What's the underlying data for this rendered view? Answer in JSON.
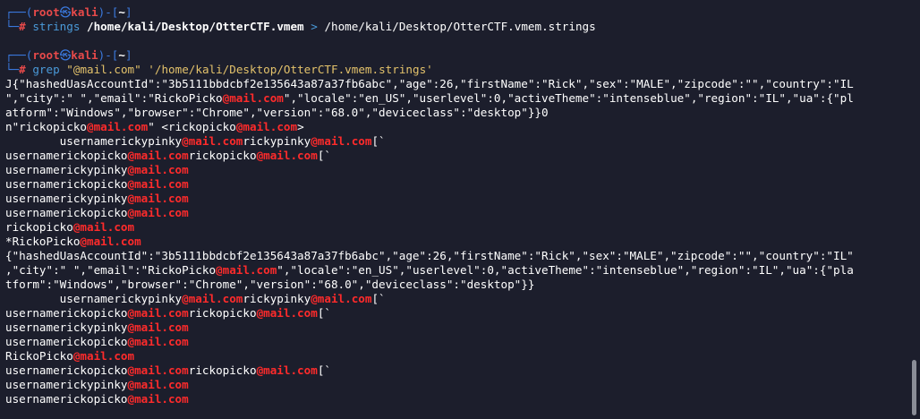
{
  "prompt": {
    "user": "root",
    "skull_icon": "skull-icon",
    "host": "kali",
    "cwd": "~"
  },
  "commands": [
    {
      "program": "strings",
      "arg1": "/home/kali/Desktop/OtterCTF.vmem",
      "operator": ">",
      "arg2": "/home/kali/Desktop/OtterCTF.vmem.strings"
    },
    {
      "program": "grep",
      "arg1": "\"@mail.com\"",
      "arg2": "'/home/kali/Desktop/OtterCTF.vmem.strings'"
    }
  ],
  "output_lines": [
    [
      "J{\"hashedUasAccountId\":\"3b5111bbdcbf2e135643a87a37fb6abc\",\"age\":26,\"firstName\":\"Rick\",\"sex\":\"MALE\",\"zipcode\":\"\",\"country\":\"IL"
    ],
    [
      "\",\"city\":\" \",\"email\":\"RickoPicko",
      "@mail.com",
      "\",\"locale\":\"en_US\",\"userlevel\":0,\"activeTheme\":\"intenseblue\",\"region\":\"IL\",\"ua\":{\"pl"
    ],
    [
      "atform\":\"Windows\",\"browser\":\"Chrome\",\"version\":\"68.0\",\"deviceclass\":\"desktop\"}}0"
    ],
    [
      "n\"rickopicko",
      "@mail.com",
      "\" <rickopicko",
      "@mail.com",
      ">"
    ],
    [
      "        usernamerickypinky",
      "@mail.com",
      "rickypinky",
      "@mail.com",
      "[`"
    ],
    [
      "usernamerickopicko",
      "@mail.com",
      "rickopicko",
      "@mail.com",
      "[`"
    ],
    [
      "usernamerickypinky",
      "@mail.com"
    ],
    [
      "usernamerickopicko",
      "@mail.com"
    ],
    [
      "usernamerickypinky",
      "@mail.com"
    ],
    [
      "usernamerickopicko",
      "@mail.com"
    ],
    [
      "rickopicko",
      "@mail.com"
    ],
    [
      "*RickoPicko",
      "@mail.com"
    ],
    [
      "{\"hashedUasAccountId\":\"3b5111bbdcbf2e135643a87a37fb6abc\",\"age\":26,\"firstName\":\"Rick\",\"sex\":\"MALE\",\"zipcode\":\"\",\"country\":\"IL\""
    ],
    [
      ",\"city\":\" \",\"email\":\"RickoPicko",
      "@mail.com",
      "\",\"locale\":\"en_US\",\"userlevel\":0,\"activeTheme\":\"intenseblue\",\"region\":\"IL\",\"ua\":{\"pla"
    ],
    [
      "tform\":\"Windows\",\"browser\":\"Chrome\",\"version\":\"68.0\",\"deviceclass\":\"desktop\"}}"
    ],
    [
      "        usernamerickypinky",
      "@mail.com",
      "rickypinky",
      "@mail.com",
      "[`"
    ],
    [
      "usernamerickopicko",
      "@mail.com",
      "rickopicko",
      "@mail.com",
      "[`"
    ],
    [
      "usernamerickypinky",
      "@mail.com"
    ],
    [
      "usernamerickopicko",
      "@mail.com"
    ],
    [
      "RickoPicko",
      "@mail.com"
    ],
    [
      "usernamerickopicko",
      "@mail.com",
      "rickopicko",
      "@mail.com",
      "[`"
    ],
    [
      "usernamerickypinky",
      "@mail.com"
    ],
    [
      "usernamerickopicko",
      "@mail.com"
    ]
  ],
  "colors": {
    "background": "#1c1e2c",
    "frame": "#3b7ae0",
    "root": "#e84a4a",
    "highlight": "#ff2b2b",
    "string": "#e3c26b",
    "command": "#4a9ad9"
  }
}
